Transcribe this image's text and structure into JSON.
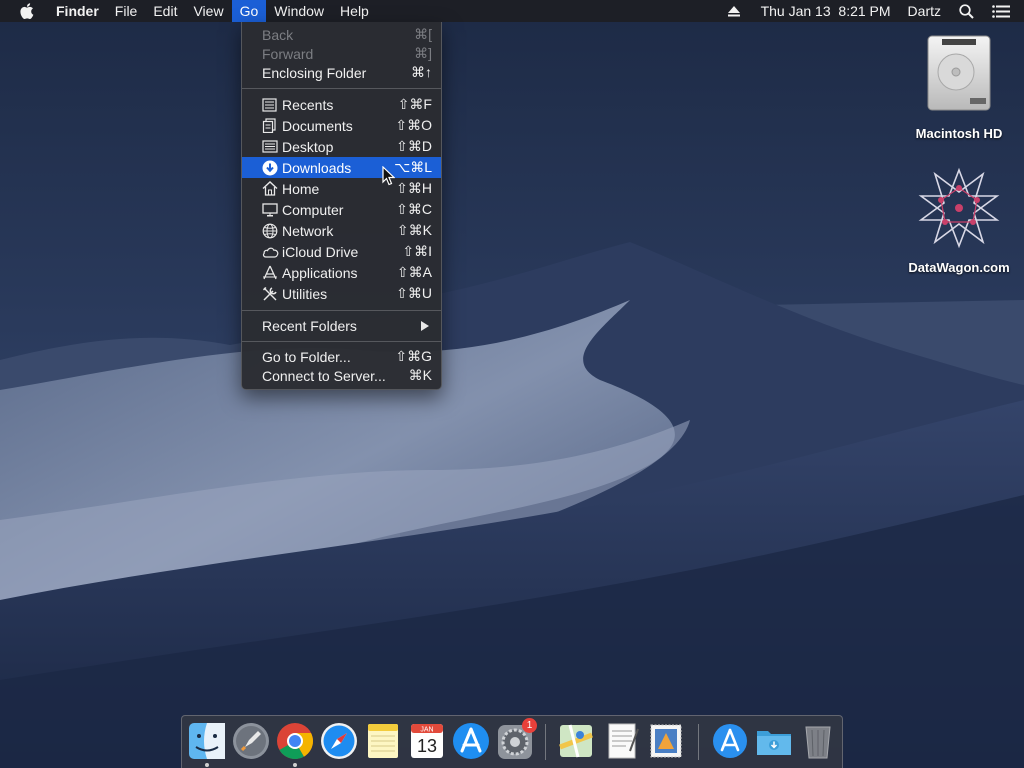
{
  "menubar": {
    "app_name": "Finder",
    "menus": [
      "File",
      "Edit",
      "View",
      "Go",
      "Window",
      "Help"
    ],
    "active_menu": "Go",
    "clock": "Thu Jan 13  8:21 PM",
    "user": "Dartz",
    "icons": [
      "apple-icon",
      "eject-icon",
      "spotlight-icon",
      "notification-center-icon"
    ]
  },
  "go_menu": {
    "items": [
      {
        "label": "Back",
        "shortcut": "⌘[",
        "enabled": false
      },
      {
        "label": "Forward",
        "shortcut": "⌘]",
        "enabled": false
      },
      {
        "label": "Enclosing Folder",
        "shortcut": "⌘↑",
        "enabled": true
      },
      {
        "label": "Recents",
        "shortcut": "⇧⌘F",
        "icon": "recents-icon"
      },
      {
        "label": "Documents",
        "shortcut": "⇧⌘O",
        "icon": "documents-icon"
      },
      {
        "label": "Desktop",
        "shortcut": "⇧⌘D",
        "icon": "desktop-icon"
      },
      {
        "label": "Downloads",
        "shortcut": "⌥⌘L",
        "icon": "downloads-icon",
        "highlighted": true
      },
      {
        "label": "Home",
        "shortcut": "⇧⌘H",
        "icon": "home-icon"
      },
      {
        "label": "Computer",
        "shortcut": "⇧⌘C",
        "icon": "computer-icon"
      },
      {
        "label": "Network",
        "shortcut": "⇧⌘K",
        "icon": "network-icon"
      },
      {
        "label": "iCloud Drive",
        "shortcut": "⇧⌘I",
        "icon": "icloud-icon"
      },
      {
        "label": "Applications",
        "shortcut": "⇧⌘A",
        "icon": "applications-icon"
      },
      {
        "label": "Utilities",
        "shortcut": "⇧⌘U",
        "icon": "utilities-icon"
      },
      {
        "label": "Recent Folders",
        "submenu": true
      },
      {
        "label": "Go to Folder...",
        "shortcut": "⇧⌘G"
      },
      {
        "label": "Connect to Server...",
        "shortcut": "⌘K"
      }
    ]
  },
  "desktop": {
    "icons": [
      {
        "label": "Macintosh HD",
        "icon": "hard-drive-icon"
      },
      {
        "label": "DataWagon.com",
        "icon": "star-ornament-icon"
      }
    ]
  },
  "dock": {
    "apps": [
      "finder-icon",
      "launchpad-icon",
      "chrome-icon",
      "safari-icon",
      "notes-icon",
      "calendar-icon",
      "app-store-icon",
      "system-preferences-icon",
      "maps-icon",
      "textedit-icon",
      "mail-stamp-icon",
      "app-store-folder-icon",
      "downloads-folder-icon",
      "trash-icon"
    ],
    "calendar_month": "JAN",
    "calendar_day": "13",
    "sysprefs_badge": "1"
  },
  "colors": {
    "highlight": "#1b5fd6",
    "menu_bg": "#2a2c32",
    "menubar_bg": "#1e1f24"
  }
}
